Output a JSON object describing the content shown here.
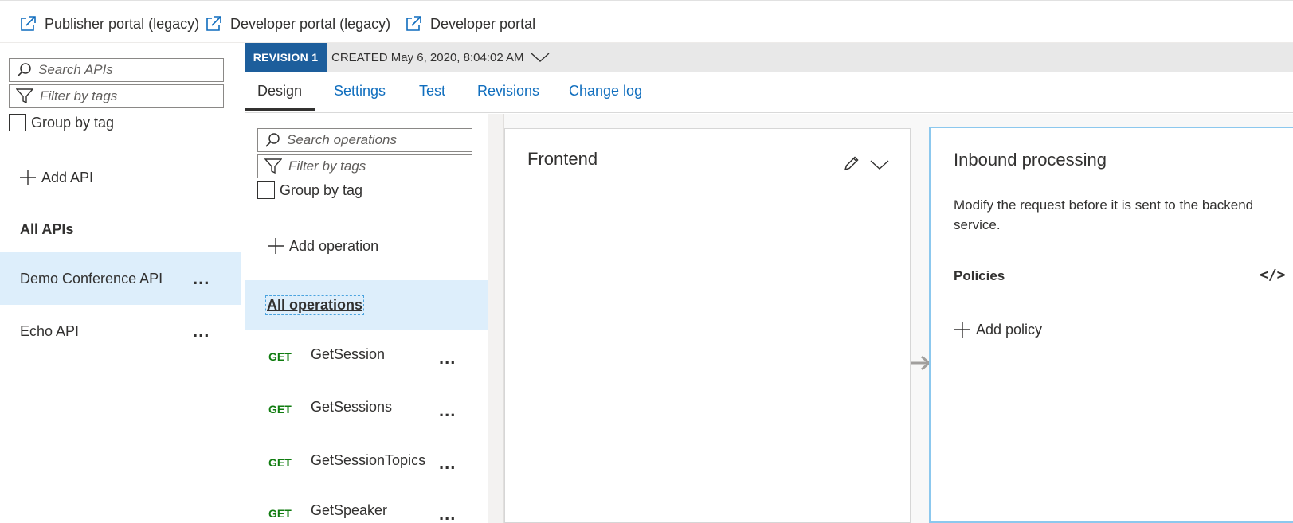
{
  "toolbar": {
    "links": [
      {
        "label": "Publisher portal (legacy)",
        "icon": "external-link-icon"
      },
      {
        "label": "Developer portal (legacy)",
        "icon": "external-link-icon"
      },
      {
        "label": "Developer portal",
        "icon": "external-link-icon"
      }
    ]
  },
  "sidebar": {
    "search_placeholder": "Search APIs",
    "filter_placeholder": "Filter by tags",
    "group_by_tag_label": "Group by tag",
    "add_api_label": "Add API",
    "all_apis_label": "All APIs",
    "apis": [
      {
        "name": "Demo Conference API",
        "selected": true,
        "more": "..."
      },
      {
        "name": "Echo API",
        "selected": false,
        "more": "..."
      }
    ]
  },
  "revision": {
    "badge": "REVISION 1",
    "created": "CREATED May 6, 2020, 8:04:02 AM"
  },
  "tabs": [
    {
      "label": "Design",
      "active": true
    },
    {
      "label": "Settings",
      "active": false
    },
    {
      "label": "Test",
      "active": false
    },
    {
      "label": "Revisions",
      "active": false
    },
    {
      "label": "Change log",
      "active": false
    }
  ],
  "operations": {
    "search_placeholder": "Search operations",
    "filter_placeholder": "Filter by tags",
    "group_by_tag_label": "Group by tag",
    "add_operation_label": "Add operation",
    "all_operations_label": "All operations",
    "items": [
      {
        "method": "GET",
        "name": "GetSession",
        "more": "..."
      },
      {
        "method": "GET",
        "name": "GetSessions",
        "more": "..."
      },
      {
        "method": "GET",
        "name": "GetSessionTopics",
        "more": "..."
      },
      {
        "method": "GET",
        "name": "GetSpeaker",
        "more": "..."
      }
    ]
  },
  "frontend": {
    "title": "Frontend"
  },
  "inbound": {
    "title": "Inbound processing",
    "description": "Modify the request before it is sent to the backend service.",
    "policies_label": "Policies",
    "code_icon_glyph": "</>",
    "add_policy_label": "Add policy"
  },
  "colors": {
    "accent": "#106ebe",
    "badge": "#1d5e9c",
    "selected_bg": "#ddeefb",
    "get_method": "#107c10",
    "inbound_border": "#8cc8ee"
  }
}
